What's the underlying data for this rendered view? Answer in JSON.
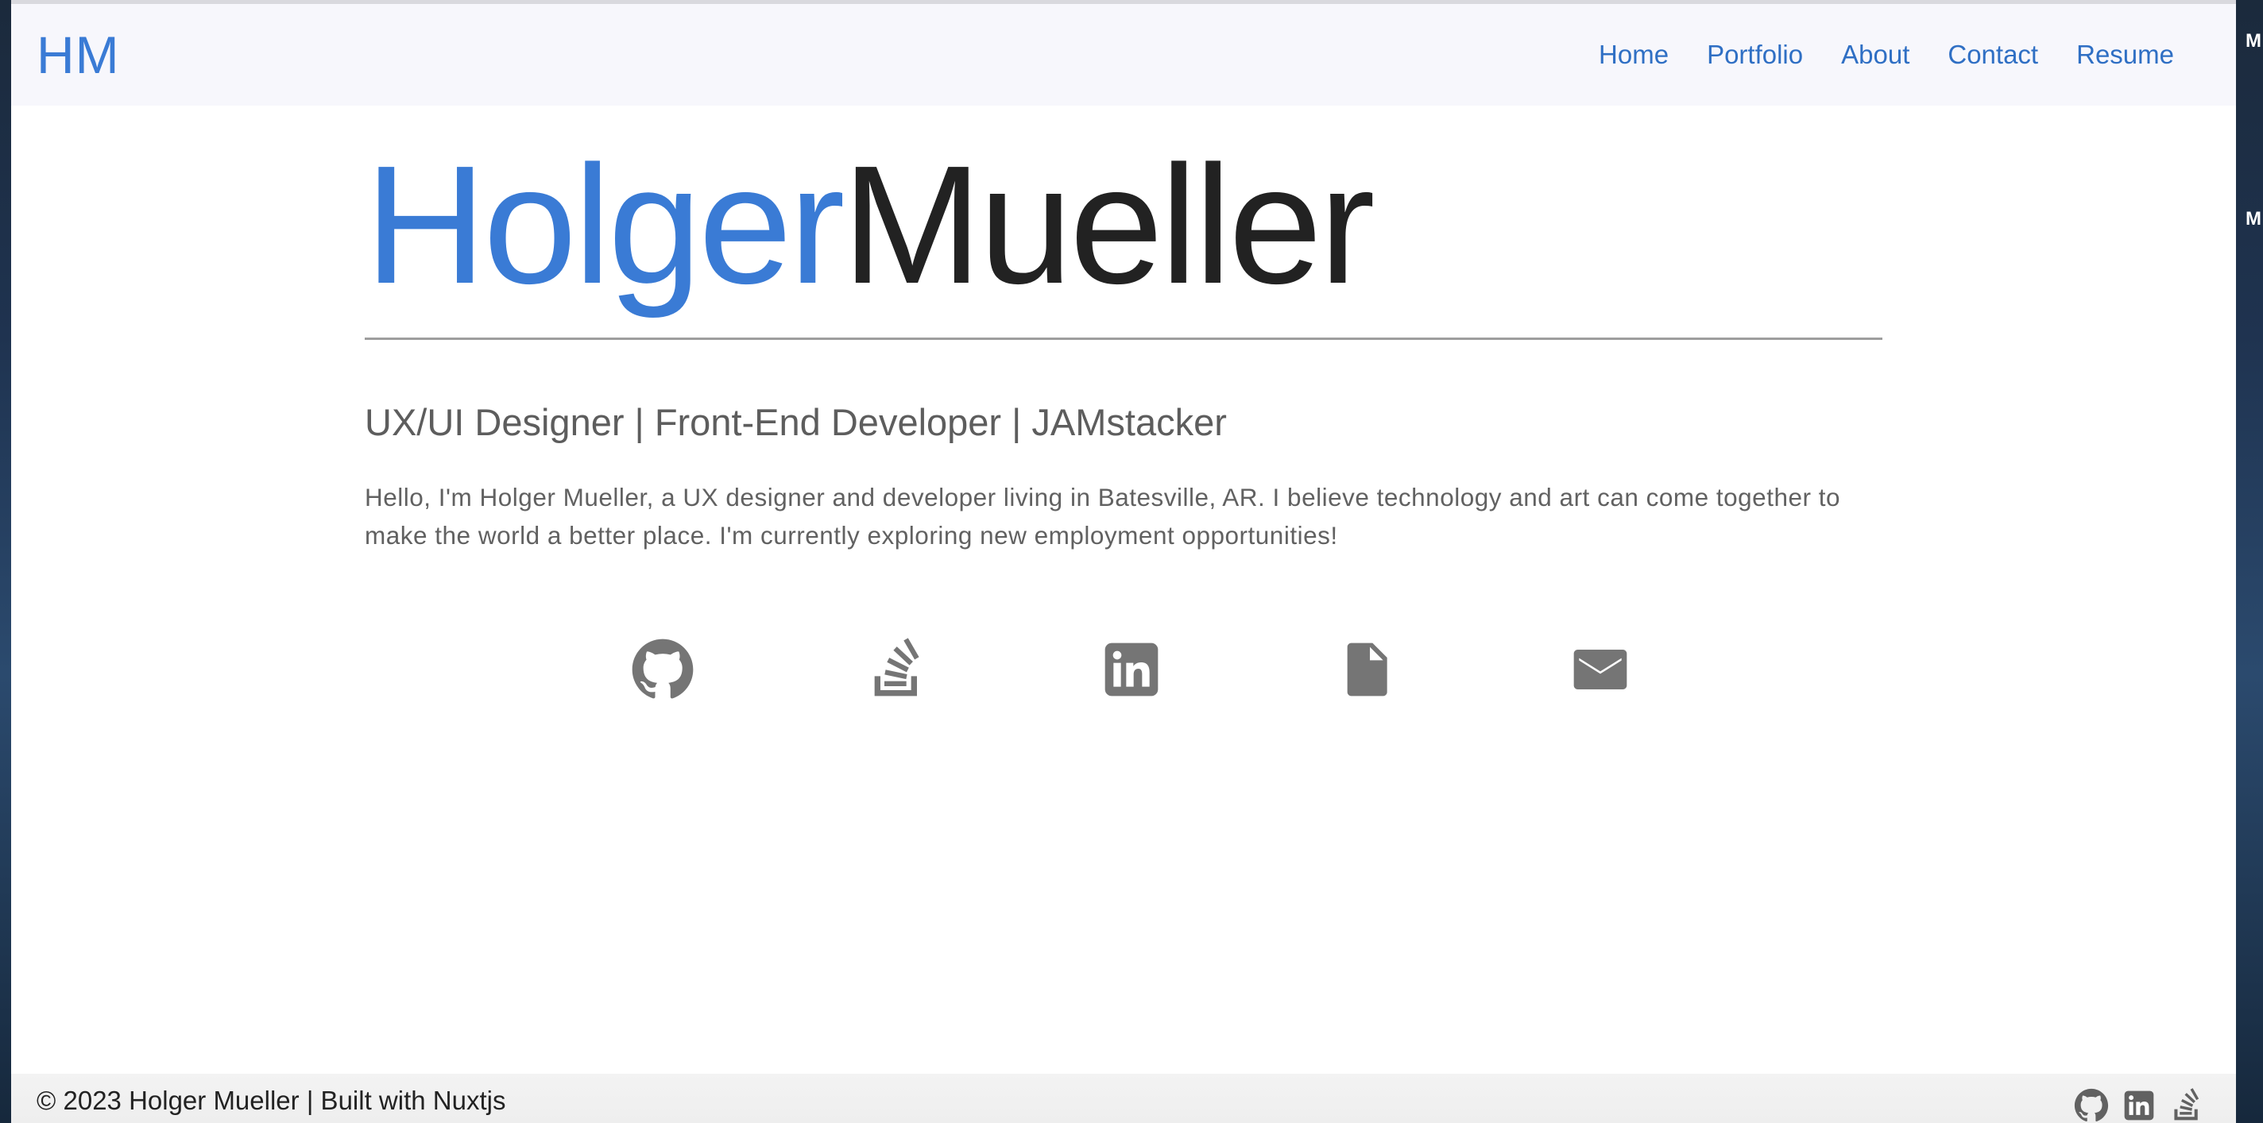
{
  "header": {
    "logo": "HM",
    "nav": [
      "Home",
      "Portfolio",
      "About",
      "Contact",
      "Resume"
    ]
  },
  "hero": {
    "first_name": "Holger",
    "last_name": "Mueller",
    "tagline": "UX/UI Designer | Front-End Developer | JAMstacker",
    "intro": "Hello, I'm Holger Mueller, a UX designer and developer living in Batesville, AR. I believe technology and art can come together to make the world a better place. I'm currently exploring new employment opportunities!"
  },
  "social_icons": [
    "github-icon",
    "stackoverflow-icon",
    "linkedin-icon",
    "document-icon",
    "email-icon"
  ],
  "footer": {
    "copyright": "© 2023 Holger Mueller | Built with Nuxtjs",
    "icons": [
      "github-icon",
      "linkedin-icon",
      "stackoverflow-icon"
    ]
  },
  "colors": {
    "accent": "#3a7bd5",
    "nav_link": "#2f6fc4",
    "icon_gray": "#757575",
    "name_dark": "#222222"
  }
}
